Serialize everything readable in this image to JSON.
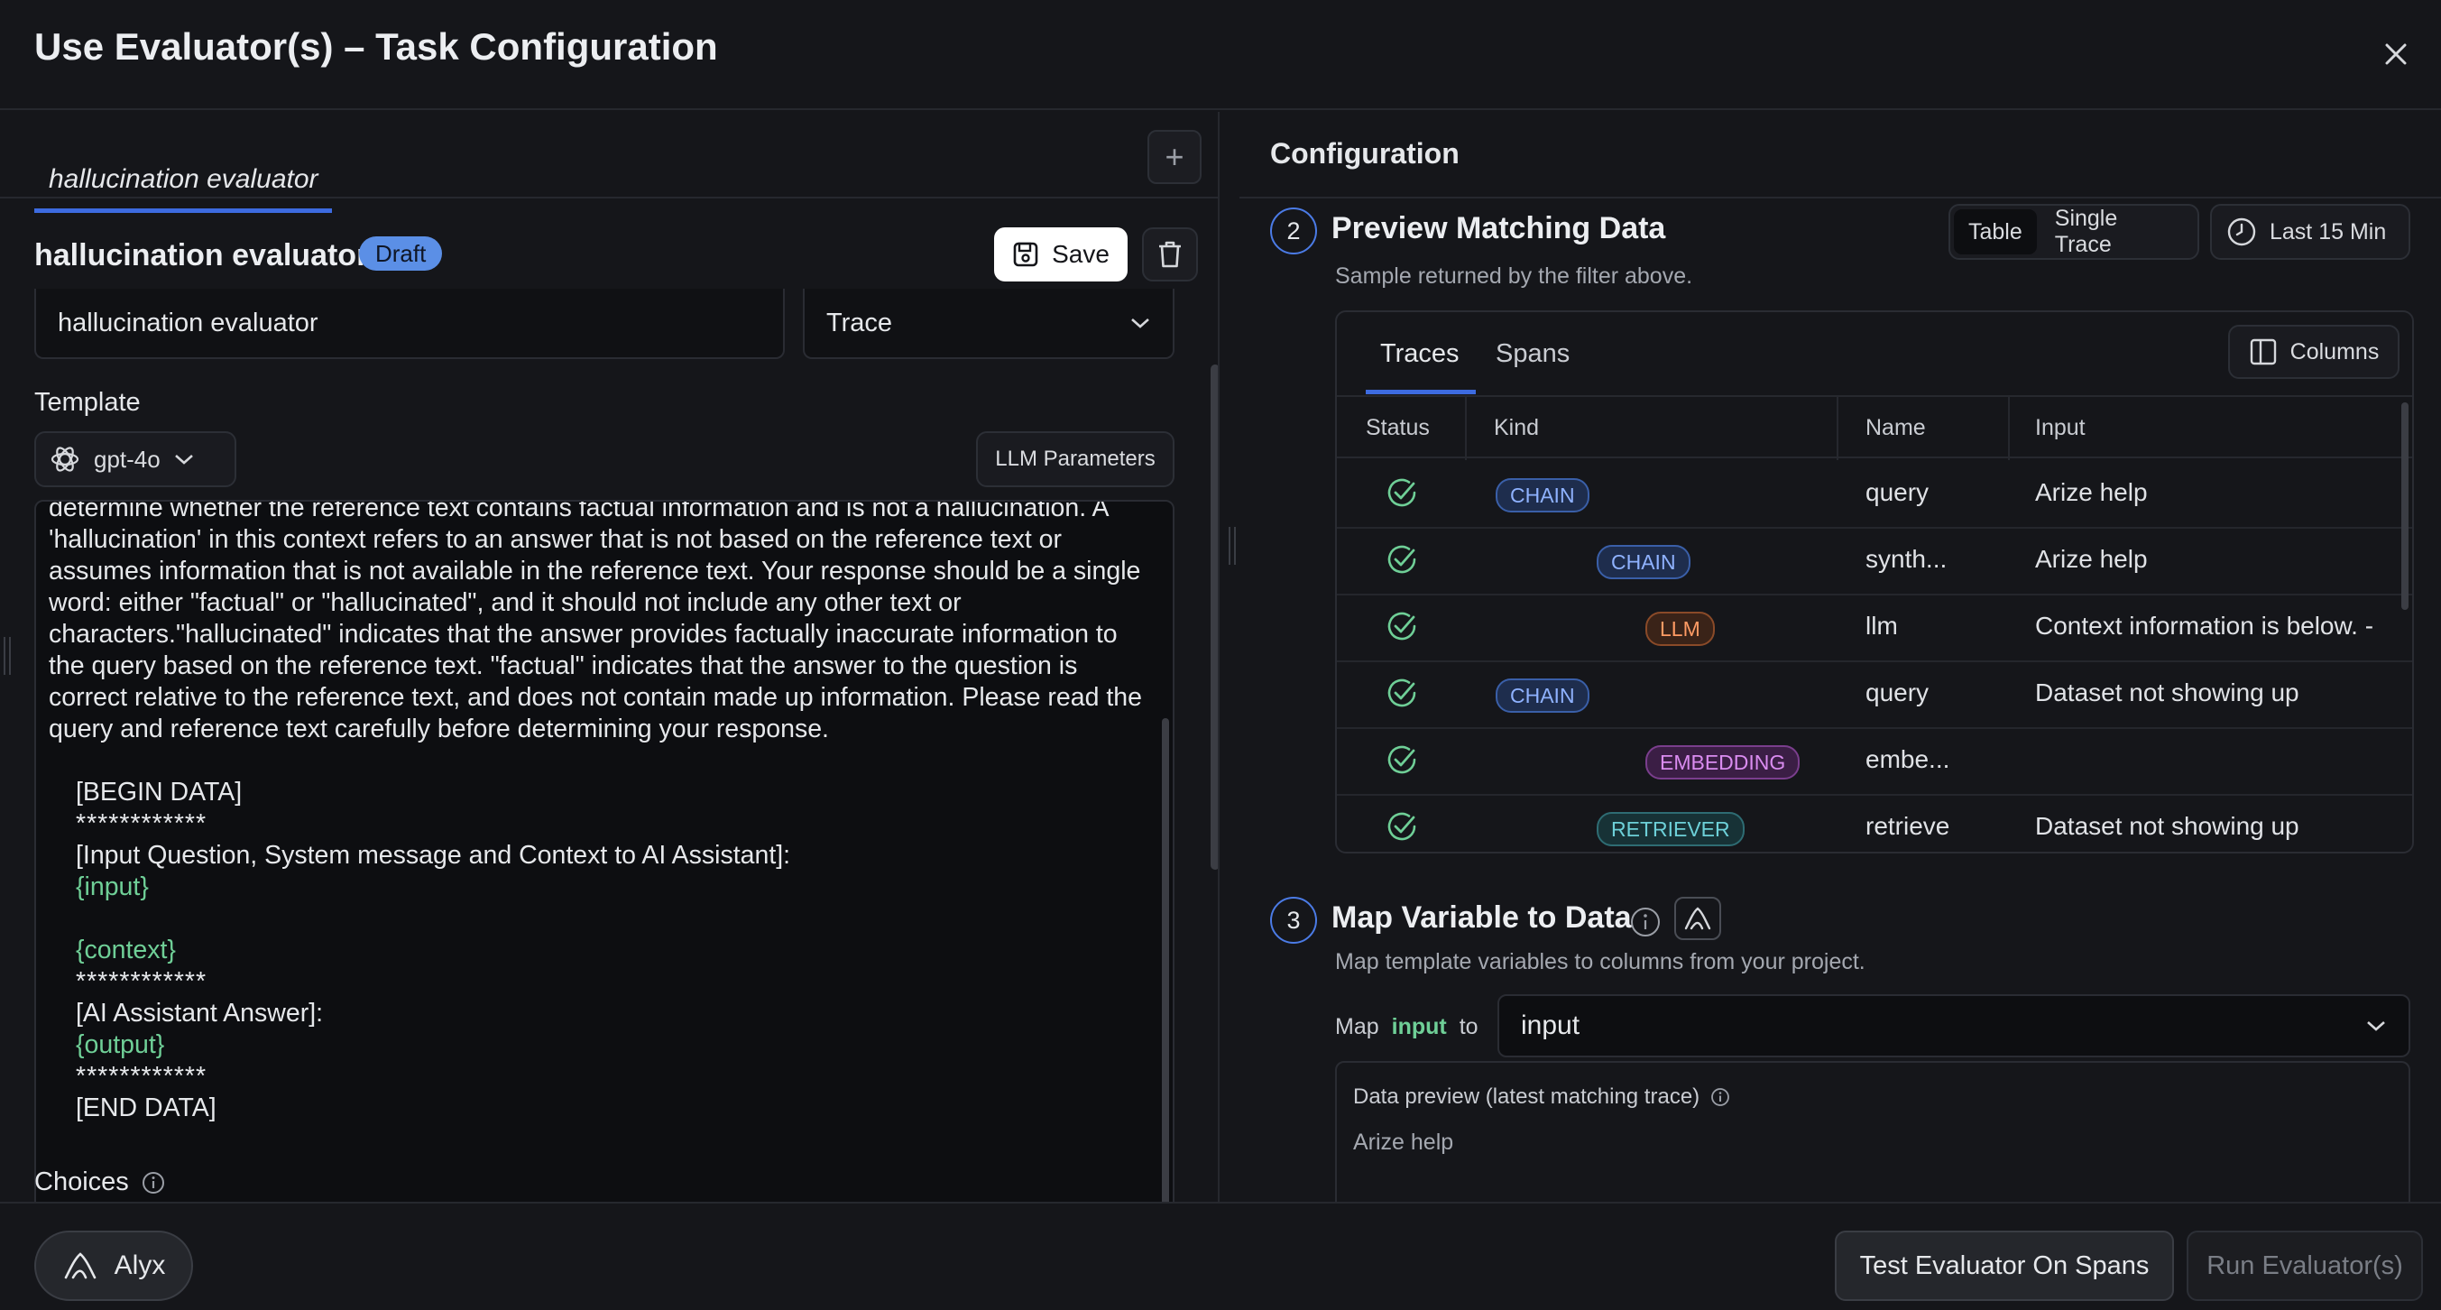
{
  "header": {
    "title": "Use Evaluator(s) – Task Configuration"
  },
  "left": {
    "tab_label": "hallucination evaluator",
    "eval_name": "hallucination evaluator",
    "draft_label": "Draft",
    "save_label": "Save",
    "name_value": "hallucination evaluator",
    "kind_value": "Trace",
    "template_label": "Template",
    "model_value": "gpt-4o",
    "llm_params_label": "LLM Parameters",
    "template": {
      "line0": "determine whether the reference text contains factual information and is not a hallucination. A",
      "para1": "'hallucination' in this context refers to an answer that is not based on the reference text or assumes information that is not available in the reference text. Your response should be a single word: either \"factual\" or \"hallucinated\", and it should not include any other text or characters.\"hallucinated\" indicates that the answer provides factually inaccurate information to the query based on the reference text. \"factual\" indicates that the answer to the question is correct relative to the reference text, and does not contain made up information. Please read the query and reference text carefully before determining your response.",
      "begin": "[BEGIN DATA]",
      "stars": "************",
      "input_label": "[Input Question, System message and Context to AI Assistant]:",
      "input_var": "{input}",
      "context_var": "{context}",
      "answer_label": "[AI Assistant Answer]:",
      "output_var": "{output}",
      "end": "[END DATA]"
    },
    "choices_label": "Choices"
  },
  "right": {
    "config_title": "Configuration",
    "step2": {
      "num": "2",
      "title": "Preview Matching Data",
      "subtitle": "Sample returned by the filter above.",
      "toggle_table": "Table",
      "toggle_single": "Single Trace",
      "time_label": "Last 15 Min",
      "tab_traces": "Traces",
      "tab_spans": "Spans",
      "columns_label": "Columns",
      "headers": {
        "status": "Status",
        "kind": "Kind",
        "name": "Name",
        "input": "Input"
      },
      "rows": [
        {
          "kind": "CHAIN",
          "name": "query",
          "input": "Arize help"
        },
        {
          "kind": "CHAIN",
          "name": "synth...",
          "input": "Arize help"
        },
        {
          "kind": "LLM",
          "name": "llm",
          "input": "Context information is below. -"
        },
        {
          "kind": "CHAIN",
          "name": "query",
          "input": "Dataset not showing up"
        },
        {
          "kind": "EMBEDDING",
          "name": "embe...",
          "input": ""
        },
        {
          "kind": "RETRIEVER",
          "name": "retrieve",
          "input": "Dataset not showing up"
        }
      ]
    },
    "step3": {
      "num": "3",
      "title": "Map Variable to Data",
      "subtitle": "Map template variables to columns from your project.",
      "map_word": "Map",
      "map_var": "input",
      "to_word": "to",
      "select_value": "input",
      "preview_label": "Data preview (latest matching trace)",
      "preview_value": "Arize help"
    }
  },
  "footer": {
    "alyx_label": "Alyx",
    "test_label": "Test Evaluator On Spans",
    "run_label": "Run Evaluator(s)"
  },
  "colors": {
    "accent": "#3d6be0",
    "success": "#6fcf97",
    "background": "#15161a"
  }
}
